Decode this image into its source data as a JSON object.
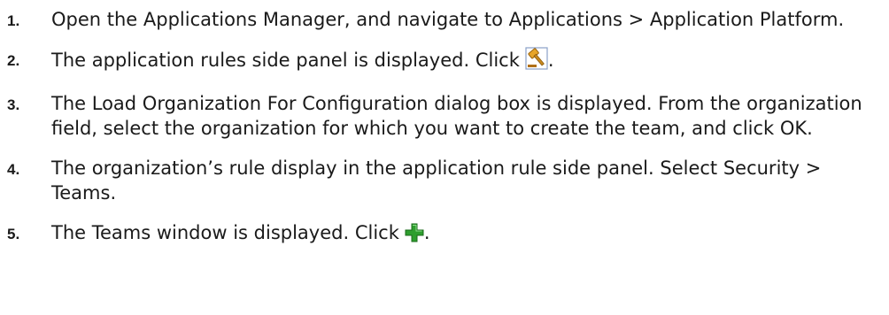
{
  "steps": [
    {
      "num": "1.",
      "text": "Open the Applications Manager, and navigate to Applications > Application Platform."
    },
    {
      "num": "2.",
      "text": "The application rules side panel is displayed. Click",
      "icon": "gavel-icon",
      "after": "."
    },
    {
      "num": "3.",
      "text": "The Load Organization For Configuration dialog box is displayed. From the organization field, select the organization for which you want to create the team, and click OK."
    },
    {
      "num": "4.",
      "text": "The organization’s rule display in the application rule side panel. Select Security > Teams."
    },
    {
      "num": "5.",
      "text": "The Teams window is displayed. Click",
      "icon": "add-plus-icon",
      "after": "."
    }
  ],
  "colors": {
    "text": "#1a1a1a",
    "plus_icon": "#2e9e2e",
    "gavel_icon": "#e0a020"
  }
}
